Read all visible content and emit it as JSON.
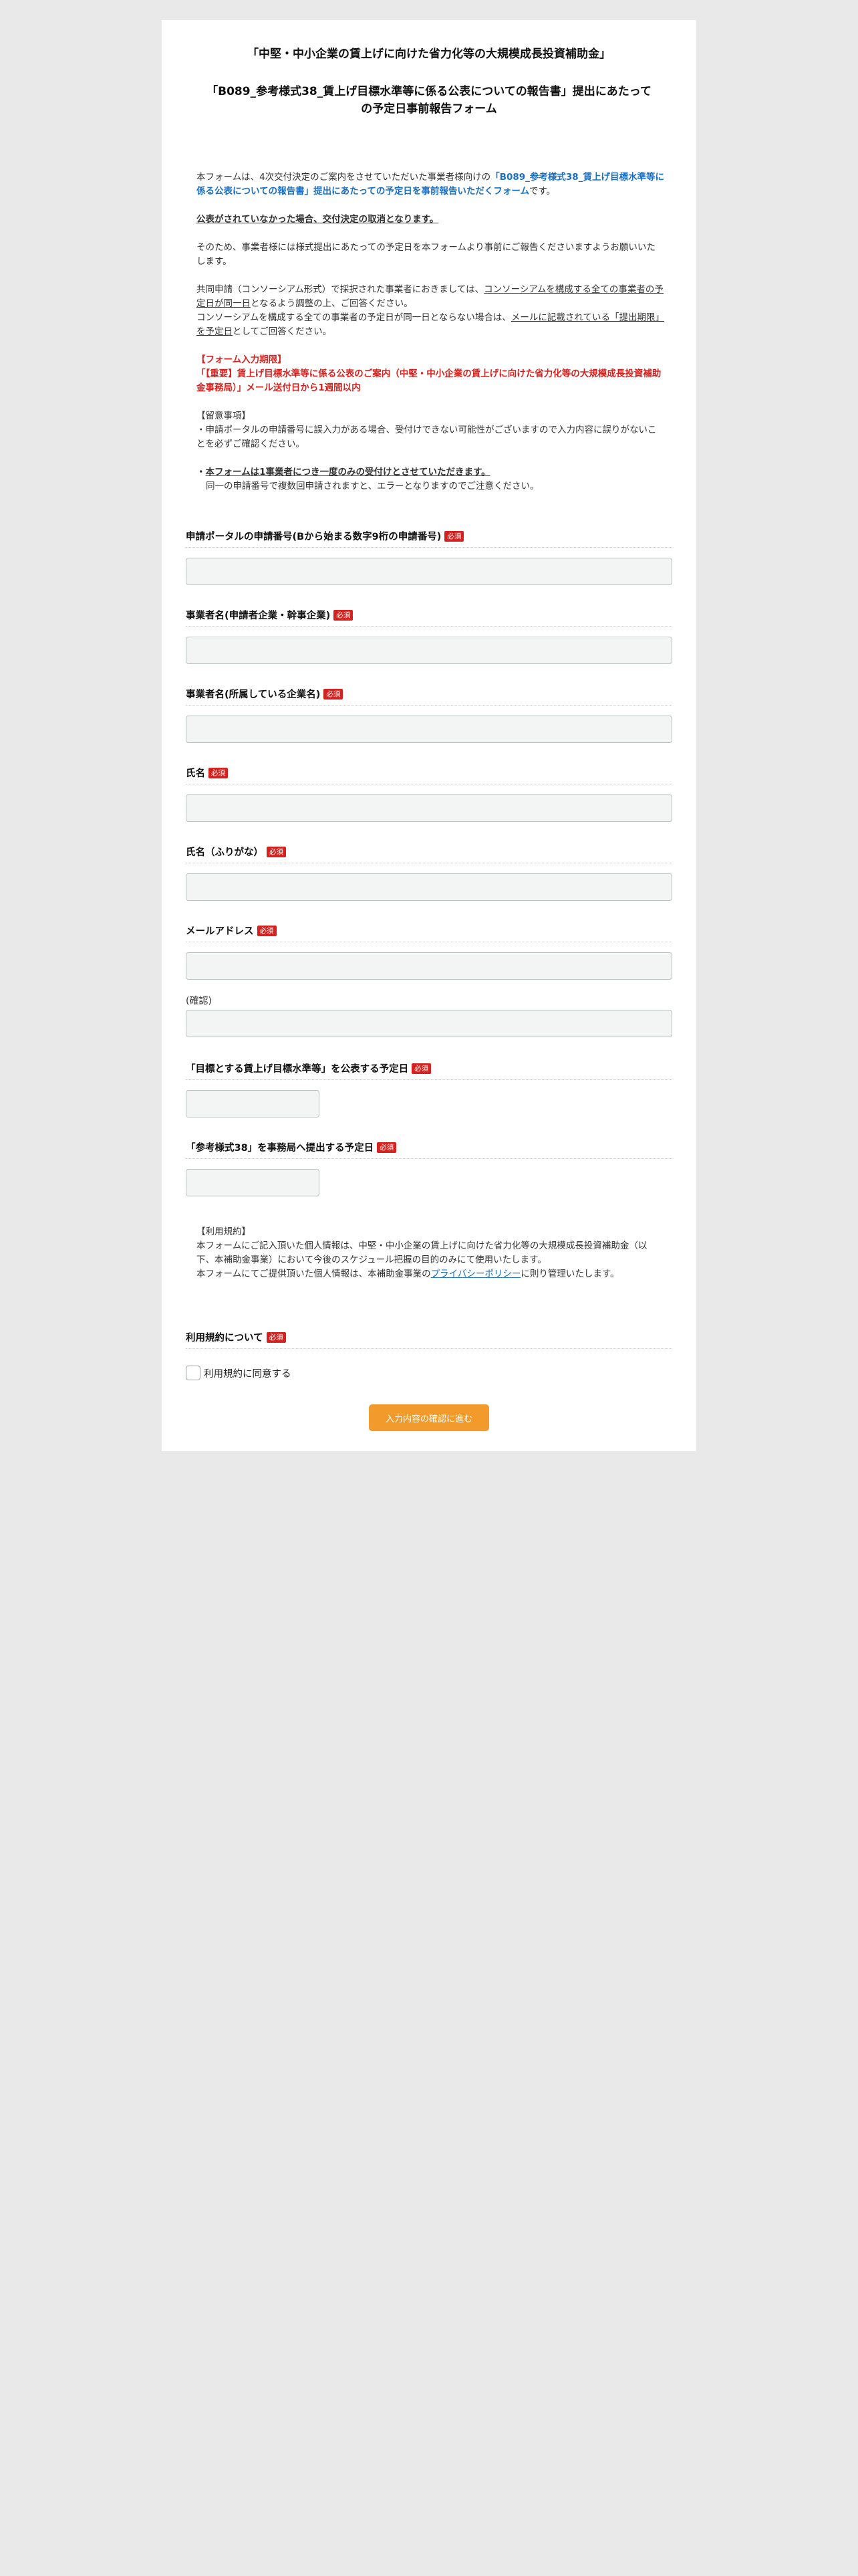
{
  "header": {
    "title_line1": "「中堅・中小企業の賃上げに向けた省力化等の大規模成長投資補助金」",
    "title_line2": "「B089_参考様式38_賃上げ目標水準等に係る公表についての報告書」提出にあたって",
    "title_line3": "の予定日事前報告フォーム"
  },
  "intro": {
    "p1_before": "本フォームは、4次交付決定のご案内をさせていただいた事業者様向けの",
    "p1_blue": "「B089_参考様式38_賃上げ目標水準等に係る公表についての報告書」提出にあたっての予定日を事前報告いただくフォーム",
    "p1_after": "です。",
    "warning_cancel": "公表がされていなかった場合、交付決定の取消となります。",
    "p2": "そのため、事業者様には様式提出にあたっての予定日を本フォームより事前にご報告くださいますようお願いいたします。",
    "p3_before": "共同申請（コンソーシアム形式）で採択された事業者におきましては、",
    "p3_ul": "コンソーシアムを構成する全ての事業者の予定日が同一日",
    "p3_after": "となるよう調整の上、ご回答ください。",
    "p4_before": "コンソーシアムを構成する全ての事業者の予定日が同一日とならない場合は、",
    "p4_ul": "メールに記載されている「提出期限」を予定日",
    "p4_after": "としてご回答ください。",
    "deadline_title": "【フォーム入力期限】",
    "deadline_body": "「【重要】賃上げ目標水準等に係る公表のご案内（中堅・中小企業の賃上げに向けた省力化等の大規模成長投資補助金事務局）」メール送付日から1週間以内",
    "notes_title": "【留意事項】",
    "notes_body": "・申請ポータルの申請番号に誤入力がある場合、受付けできない可能性がございますので入力内容に誤りがないことを必ずご確認ください。",
    "once_prefix": "・",
    "once_ul": "本フォームは1事業者につき一度のみの受付けとさせていただきます。",
    "once_note": "同一の申請番号で複数回申請されますと、エラーとなりますのでご注意ください。"
  },
  "required_badge": "必須",
  "fields": [
    {
      "label": "申請ポータルの申請番号(Bから始まる数字9桁の申請番号)"
    },
    {
      "label": "事業者名(申請者企業・幹事企業)"
    },
    {
      "label": "事業者名(所属している企業名)"
    },
    {
      "label": "氏名"
    },
    {
      "label": "氏名（ふりがな）"
    },
    {
      "label": "メールアドレス",
      "confirm_label": "(確認)"
    },
    {
      "label": "「目標とする賃上げ目標水準等」を公表する予定日"
    },
    {
      "label": "「参考様式38」を事務局へ提出する予定日"
    }
  ],
  "terms": {
    "title": "【利用規約】",
    "body": "本フォームにご記入頂いた個人情報は、中堅・中小企業の賃上げに向けた省力化等の大規模成長投資補助金（以下、本補助金事業）において今後のスケジュール把握の目的のみにて使用いたします。",
    "body2_before": "本フォームにてご提供頂いた個人情報は、本補助金事業の",
    "privacy_link": "プライバシーポリシー",
    "body2_after": "に則り管理いたします。"
  },
  "agreement": {
    "label": "利用規約について",
    "checkbox_label": "利用規約に同意する"
  },
  "submit_label": "入力内容の確認に進む"
}
